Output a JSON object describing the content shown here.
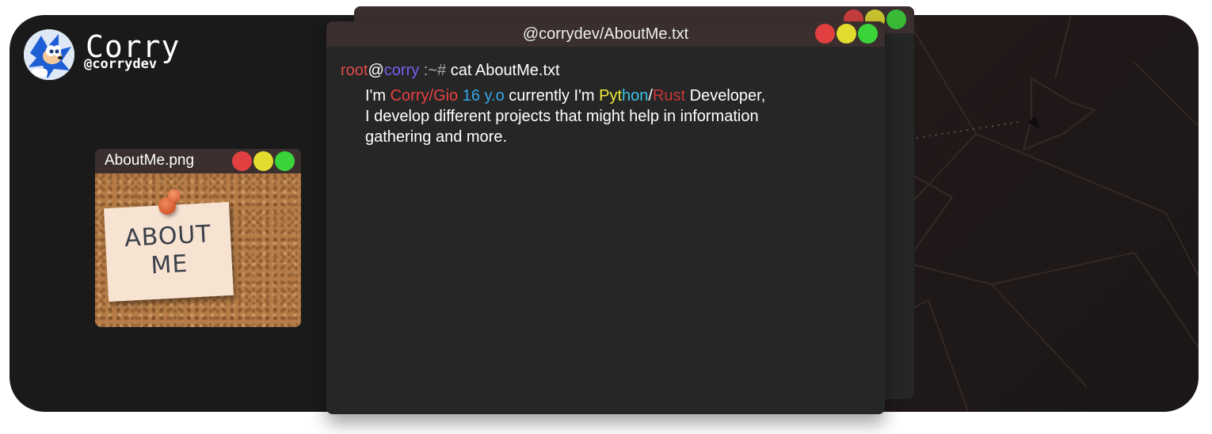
{
  "profile": {
    "name": "Corry",
    "handle": "@corrydev",
    "avatar_icon": "hedgehog-avatar-icon"
  },
  "image_window": {
    "title": "AboutMe.png",
    "note_line1": "ABOUT",
    "note_line2": "ME"
  },
  "terminal": {
    "title": "@corrydev/AboutMe.txt",
    "prompt_user": "root",
    "prompt_at": "@",
    "prompt_host": "corry",
    "prompt_path": " :~# ",
    "command": "cat AboutMe.txt",
    "output": {
      "p1": "I'm ",
      "name": "Corry/Gio",
      "sp1": " ",
      "age": "16 y.o",
      "p2": " currently I'm ",
      "py1": "Pyt",
      "py2": "hon",
      "slash": "/",
      "rust": "Rust",
      "p3": " Developer,",
      "line2": "I develop different projects that might help in information",
      "line3": "gathering and more."
    }
  },
  "colors": {
    "card_bg": "#1a1a1a",
    "titlebar": "#3a2e2e",
    "terminal_bg": "#262626",
    "close": "#e04040",
    "minimize": "#e2dc2f",
    "maximize": "#3ad33a"
  }
}
